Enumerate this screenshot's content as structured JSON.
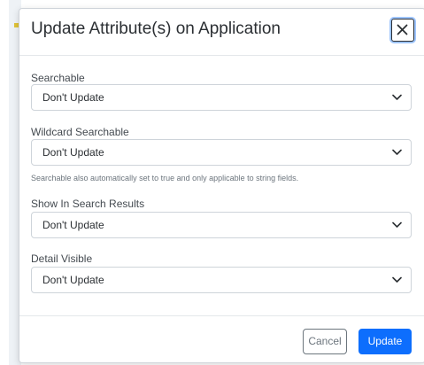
{
  "modal": {
    "title": "Update Attribute(s) on Application",
    "close_icon": "close-icon"
  },
  "fields": [
    {
      "label": "Searchable",
      "value": "Don't Update"
    },
    {
      "label": "Wildcard Searchable",
      "value": "Don't Update",
      "help": "Searchable also automatically set to true and only applicable to string fields."
    },
    {
      "label": "Show In Search Results",
      "value": "Don't Update"
    },
    {
      "label": "Detail Visible",
      "value": "Don't Update"
    }
  ],
  "footer": {
    "cancel_label": "Cancel",
    "update_label": "Update"
  },
  "colors": {
    "primary": "#0d6efd",
    "secondary": "#6c757d",
    "focus_ring": "#9ec5fe"
  }
}
